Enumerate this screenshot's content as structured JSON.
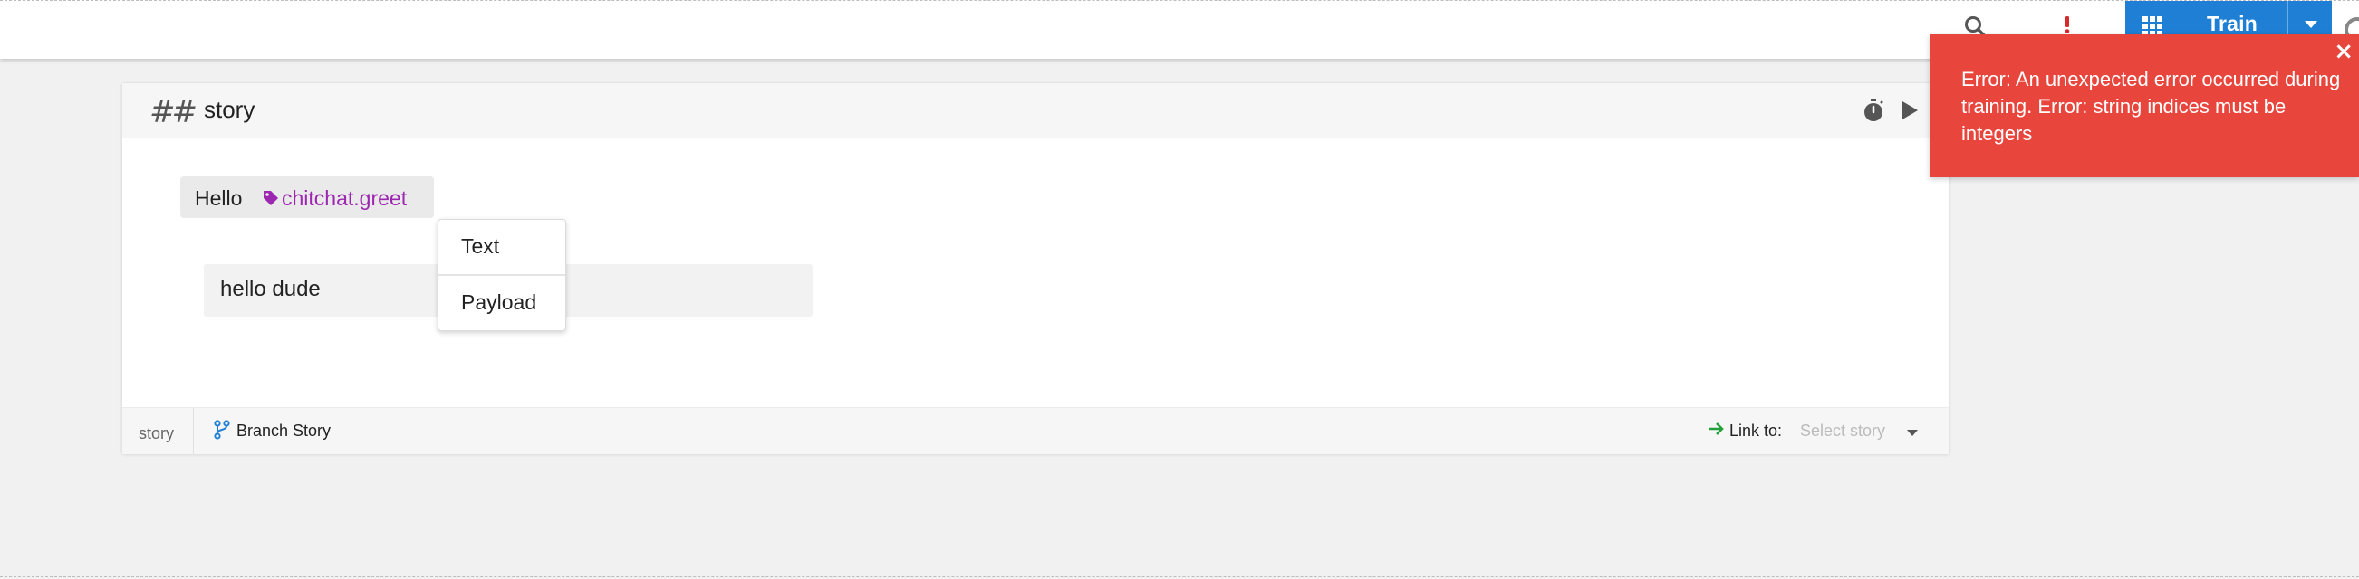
{
  "header": {
    "train_label": "Train"
  },
  "story": {
    "title": "story",
    "user_message": {
      "text": "Hello",
      "intent": "chitchat.greet"
    },
    "bot_response": {
      "text": "hello dude"
    },
    "type_menu": {
      "items": [
        "Text",
        "Payload"
      ]
    },
    "footer": {
      "story_tab": "story",
      "branch_label": "Branch Story",
      "link_to_label": "Link to:",
      "select_placeholder": "Select story"
    }
  },
  "toast": {
    "close": "×",
    "message": "Error: An unexpected error occurred during training. Error: string indices must be integers"
  },
  "colors": {
    "train_blue": "#1e7fd4",
    "error_red": "#e8453c",
    "intent_purple": "#9c27b0",
    "link_green": "#21a03a"
  }
}
